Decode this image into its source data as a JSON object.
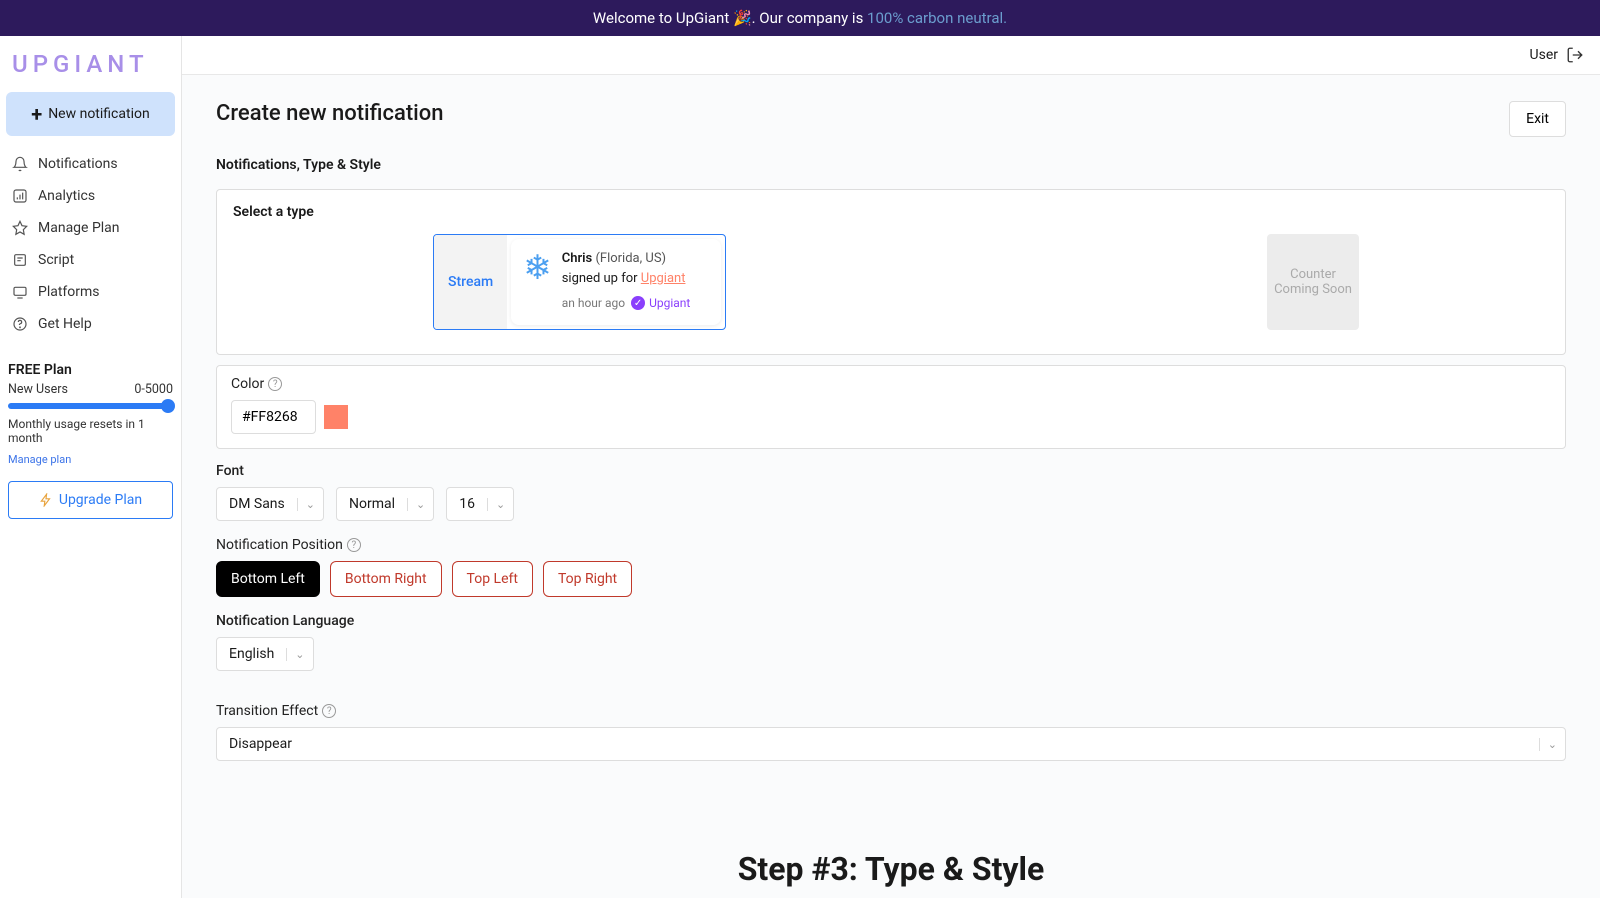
{
  "banner": {
    "text_prefix": "Welcome to UpGiant 🎉. Our company is ",
    "link_text": "100% carbon neutral."
  },
  "logo": "UPGIANT",
  "new_notification_btn": "New notification",
  "sidebar": {
    "items": [
      "Notifications",
      "Analytics",
      "Manage Plan",
      "Script",
      "Platforms",
      "Get Help"
    ]
  },
  "plan": {
    "title": "FREE Plan",
    "metric": "New Users",
    "range": "0-5000",
    "note": "Monthly usage resets in 1 month",
    "manage_link": "Manage plan",
    "upgrade": "Upgrade Plan"
  },
  "topbar": {
    "user": "User"
  },
  "page": {
    "title": "Create new notification",
    "exit": "Exit",
    "section": "Notifications, Type & Style"
  },
  "type_select": {
    "label": "Select a type",
    "stream": "Stream",
    "counter": "Counter",
    "coming_soon": "Coming Soon"
  },
  "preview": {
    "name": "Chris",
    "location": "(Florida,  US)",
    "action": "signed up for ",
    "brand": "Upgiant",
    "time": "an hour ago",
    "verified": "Upgiant"
  },
  "color": {
    "label": "Color",
    "value": "#FF8268"
  },
  "font": {
    "label": "Font",
    "family": "DM Sans",
    "weight": "Normal",
    "size": "16"
  },
  "position": {
    "label": "Notification Position",
    "options": [
      "Bottom Left",
      "Bottom Right",
      "Top Left",
      "Top Right"
    ]
  },
  "language": {
    "label": "Notification Language",
    "value": "English"
  },
  "transition": {
    "label": "Transition Effect",
    "value": "Disappear"
  },
  "overlay": "Step #3: Type & Style"
}
